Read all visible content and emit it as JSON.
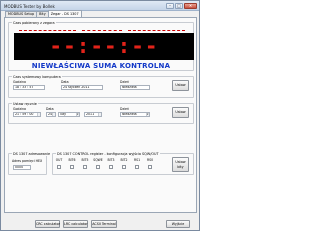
{
  "window": {
    "title": "MODBUS Tester by Bollek",
    "buttons": [
      "–",
      "□",
      "✕"
    ]
  },
  "tabs": [
    "MODBUS Setup",
    "Bity",
    "Zegar - DS 1307"
  ],
  "led_group": {
    "label": "Czas pobierany z zegara",
    "digits": "--:--:--",
    "message": "NIEWŁAŚCIWA SUMA KONTROLNA"
  },
  "computer_time": {
    "label": "Czas systemowy komputera",
    "hour_label": "Godzina",
    "date_label": "Data",
    "day_label": "Dzień",
    "hour_value": "18 : 33 : 57",
    "date_value": "24 styczeń 2011",
    "day_value": "Niedziela",
    "update_button": "Ustaw"
  },
  "manual_time": {
    "label": "Ustaw ręcznie",
    "hour_label": "Godzina",
    "date_label": "Data",
    "day_label": "Dzień",
    "hour_value": "21 : 59 : 00",
    "date_day": "24",
    "date_month": "luty",
    "date_year": "2011",
    "day_value": "Niedziela",
    "set_button": "Ustaw"
  },
  "address_group": {
    "label": "DS 1307 adresowanie",
    "field_label": "Adres pamięci HEX",
    "field_value": "0000"
  },
  "control_group": {
    "label": "DS 1307 CONTROL register - konfiguracja wyjścia SQW/OUT",
    "bits": [
      "OUT",
      "BIT6",
      "BIT5",
      "SQWE",
      "BIT3",
      "BIT2",
      "RS1",
      "RS0"
    ],
    "set_button": "Ustaw bity"
  },
  "footer": {
    "buttons": [
      "CRC calculator",
      "LRC calculator",
      "ACSII Terminal",
      "Wyjście"
    ]
  }
}
